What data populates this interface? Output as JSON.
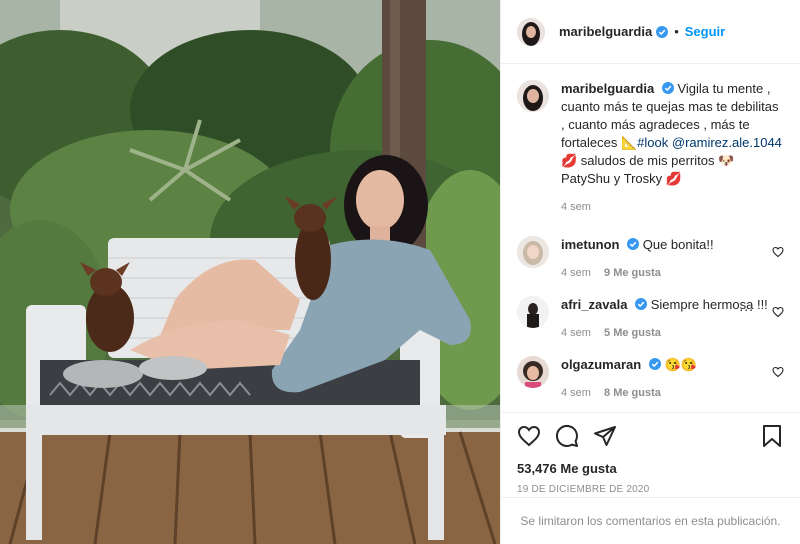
{
  "post": {
    "author": "maribelguardia",
    "separator": "•",
    "follow_label": "Seguir",
    "verified_icon": "verified-badge-icon",
    "accent_color": "#0095f6",
    "tag_color": "#00376b"
  },
  "caption": {
    "username": "maribelguardia",
    "text_1": "Vigila tu mente , cuanto más te quejas mas te debilitas , cuanto más agradeces , más te fortaleces ",
    "emoji_1": "📐",
    "hashtag": "#look",
    "mention": "@ramirez.ale.1044",
    "emoji_2": "💋",
    "text_2": " saludos de mis perritos ",
    "emoji_3": "🐶",
    "text_3": " PatyShu y Trosky ",
    "emoji_4": "💋",
    "time": "4 sem"
  },
  "comments": [
    {
      "username": "imetunon",
      "text": "Que bonita!!",
      "time": "4 sem",
      "likes": "9 Me gusta"
    },
    {
      "username": "afri_zavala",
      "text": "Siempre hermosa !!!",
      "time": "4 sem",
      "likes": "5 Me gusta"
    },
    {
      "username": "olgazumaran",
      "text": "😘😘",
      "time": "4 sem",
      "likes": "8 Me gusta"
    }
  ],
  "more_label": "...",
  "stats": {
    "likes": "53,476 Me gusta",
    "date": "19 DE DICIEMBRE DE 2020"
  },
  "footer": {
    "limited_comments": "Se limitaron los comentarios en esta publicación."
  }
}
